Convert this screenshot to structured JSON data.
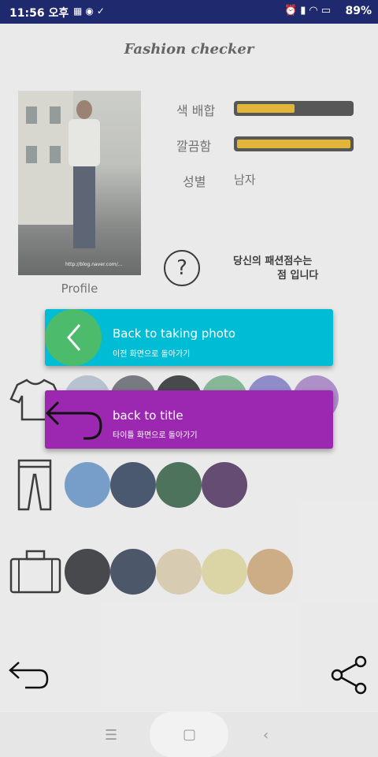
{
  "status_bar": {
    "time": "11:56 오후",
    "battery": "89%",
    "left_icons": [
      "grid-icon",
      "chat-icon",
      "check-icon"
    ],
    "right_icons": [
      "alarm-icon",
      "signal-icon",
      "wifi-icon",
      "battery-icon"
    ]
  },
  "app": {
    "title": "Fashion checker"
  },
  "profile": {
    "label": "Profile",
    "watermark_line1": "http://blog.naver.com/..."
  },
  "stats": {
    "color_combo": {
      "label": "색 배합",
      "level": 0.53
    },
    "neatness": {
      "label": "깔끔함",
      "level": 1.0
    },
    "gender": {
      "label": "성별",
      "value": "남자"
    }
  },
  "score": {
    "line1": "당신의 패션점수는",
    "line2": "점 입니다"
  },
  "categories": [
    {
      "name": "top",
      "icon": "shirt-icon",
      "colors": [
        "#aebccb",
        "#5b6068",
        "#1e2126",
        "#6fae85",
        "#7a77c4",
        "#a07bc2"
      ]
    },
    {
      "name": "bottom",
      "icon": "pants-icon",
      "colors": [
        "#5b8ec4",
        "#233552",
        "#27573a",
        "#452555"
      ]
    },
    {
      "name": "bag",
      "icon": "suitcase-icon",
      "colors": [
        "#1f2124",
        "#253449",
        "#d7c7a6",
        "#dcd497",
        "#caa06d"
      ]
    }
  ],
  "menu": {
    "back_photo": {
      "title": "Back to taking photo",
      "subtitle": "이전 화면으로 돌아가기"
    },
    "back_title": {
      "title": "back to title",
      "subtitle": "타이틀 화면으로 돌아가기"
    }
  },
  "colors": {
    "status_bar": "#1f2a6e",
    "card_cyan": "#00bcd4",
    "card_purple": "#9c27b0",
    "fab_green": "#4cbb6c",
    "bar_fill": "#e3a90e"
  }
}
